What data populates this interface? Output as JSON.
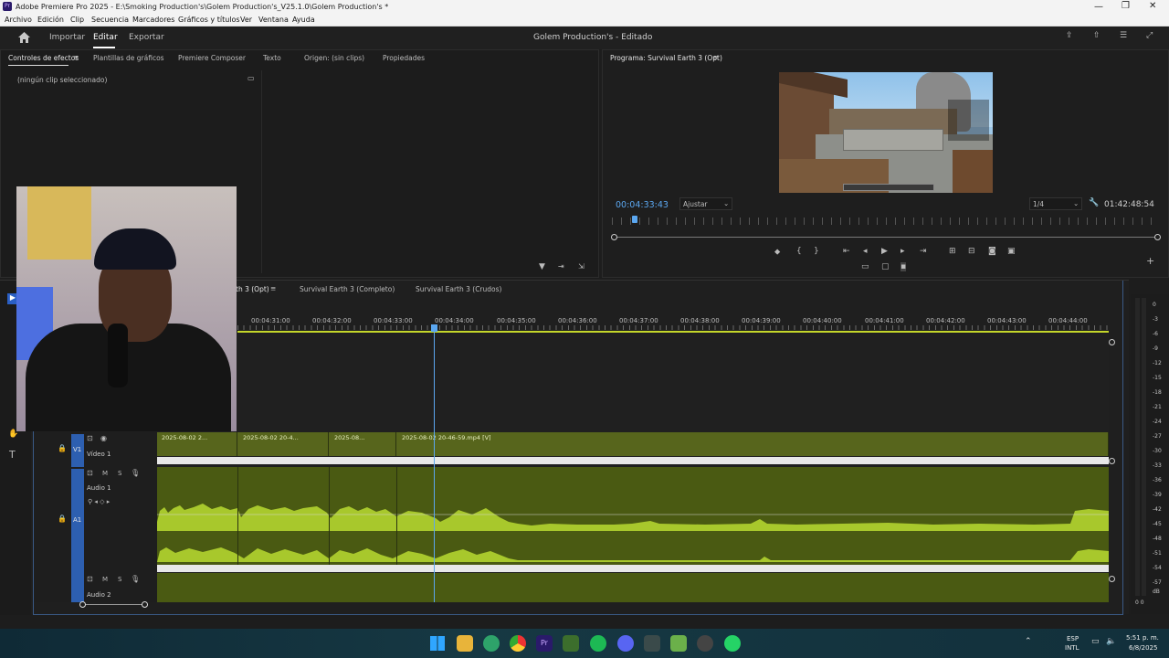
{
  "titlebar": {
    "title": "Adobe Premiere Pro 2025 - E:\\Smoking Production's\\Golem Production's_V25.1.0\\Golem Production's *"
  },
  "menu": [
    "Archivo",
    "Edición",
    "Clip",
    "Secuencia",
    "Marcadores",
    "Gráficos y títulos",
    "Ver",
    "Ventana",
    "Ayuda"
  ],
  "appbar": {
    "home_icon": "home-icon",
    "modes": [
      "Importar",
      "Editar",
      "Exportar"
    ],
    "active_mode": "Editar",
    "project_title": "Golem Production's - Editado"
  },
  "effects_panel": {
    "tabs": [
      "Controles de efectos",
      "Plantillas de gráficos",
      "Premiere Composer",
      "Texto",
      "Origen: (sin clips)",
      "Propiedades"
    ],
    "active_tab": "Controles de efectos",
    "empty_text": "(ningún clip seleccionado)"
  },
  "program_monitor": {
    "title": "Programa: Survival Earth 3 (Opt)",
    "timecode": "00:04:33:43",
    "fit_option": "Ajustar",
    "resolution": "1/4",
    "duration": "01:42:48:54"
  },
  "timeline": {
    "tabs": [
      "th 3 (Opt)",
      "Survival Earth 3 (Completo)",
      "Survival Earth 3 (Crudos)"
    ],
    "ruler_labels": [
      "00:04:31:00",
      "00:04:32:00",
      "00:04:33:00",
      "00:04:34:00",
      "00:04:35:00",
      "00:04:36:00",
      "00:04:37:00",
      "00:04:38:00",
      "00:04:39:00",
      "00:04:40:00",
      "00:04:41:00",
      "00:04:42:00",
      "00:04:43:00",
      "00:04:44:00"
    ],
    "tracks": {
      "v1_label": "V1",
      "v1_name": "Vídeo 1",
      "a1_label": "A1",
      "a1_name": "Audio 1",
      "a2_name": "Audio 2",
      "mute": "M",
      "solo": "S"
    },
    "clips": [
      "2025-08-02 2...",
      "2025-08-02 20-4...",
      "2025-08...",
      "2025-08-02 20-46-59.mp4 [V]"
    ]
  },
  "meter": {
    "labels": [
      "0",
      "-3",
      "-6",
      "-9",
      "-12",
      "-15",
      "-18",
      "-21",
      "-24",
      "-27",
      "-30",
      "-33",
      "-36",
      "-39",
      "-42",
      "-45",
      "-48",
      "-51",
      "-54",
      "-57",
      "dB"
    ],
    "bottom": "0 0"
  },
  "taskbar": {
    "lang1": "ESP",
    "lang2": "INTL",
    "time": "5:51 p. m.",
    "date": "6/8/2025"
  }
}
